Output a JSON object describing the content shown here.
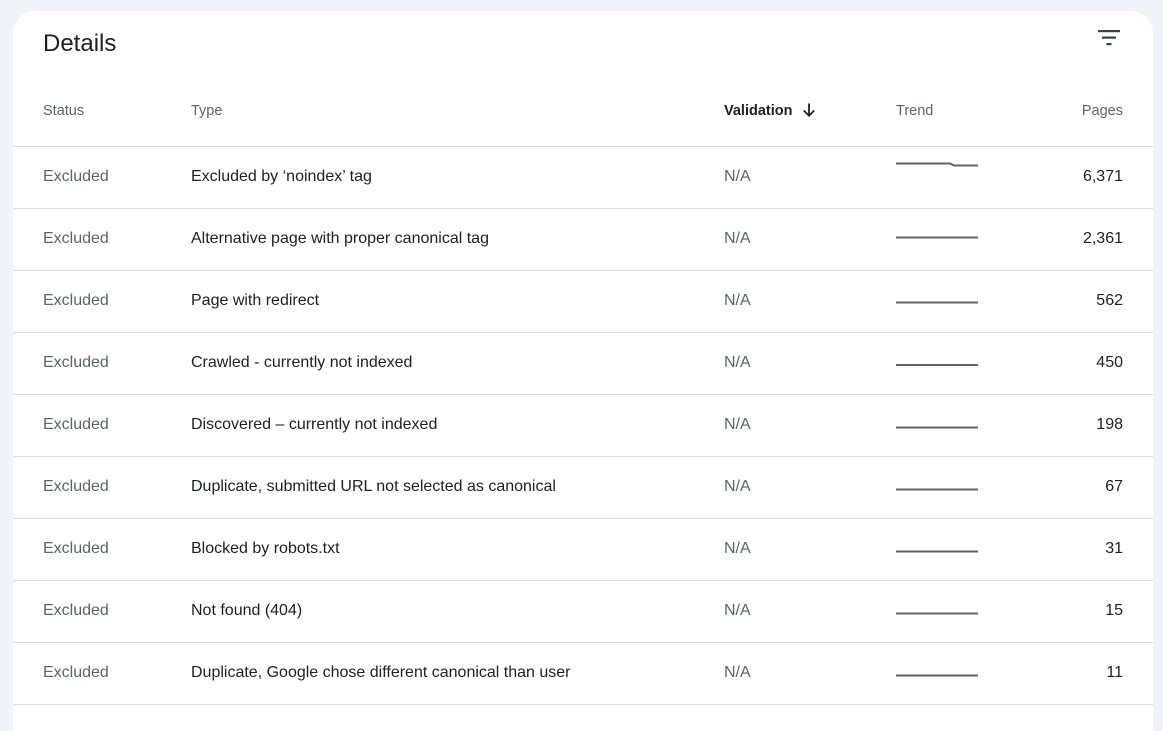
{
  "card": {
    "title": "Details",
    "filter_icon": "filter-list-icon"
  },
  "columns": {
    "status": "Status",
    "type": "Type",
    "validation": "Validation",
    "trend": "Trend",
    "pages": "Pages",
    "sort_icon": "arrow-down-icon"
  },
  "rows": [
    {
      "status": "Excluded",
      "type": "Excluded by ‘noindex’ tag",
      "validation": "N/A",
      "pages": "6,371"
    },
    {
      "status": "Excluded",
      "type": "Alternative page with proper canonical tag",
      "validation": "N/A",
      "pages": "2,361"
    },
    {
      "status": "Excluded",
      "type": "Page with redirect",
      "validation": "N/A",
      "pages": "562"
    },
    {
      "status": "Excluded",
      "type": "Crawled - currently not indexed",
      "validation": "N/A",
      "pages": "450"
    },
    {
      "status": "Excluded",
      "type": "Discovered – currently not indexed",
      "validation": "N/A",
      "pages": "198"
    },
    {
      "status": "Excluded",
      "type": "Duplicate, submitted URL not selected as canonical",
      "validation": "N/A",
      "pages": "67"
    },
    {
      "status": "Excluded",
      "type": "Blocked by robots.txt",
      "validation": "N/A",
      "pages": "31"
    },
    {
      "status": "Excluded",
      "type": "Not found (404)",
      "validation": "N/A",
      "pages": "15"
    },
    {
      "status": "Excluded",
      "type": "Duplicate, Google chose different canonical than user",
      "validation": "N/A",
      "pages": "11"
    }
  ],
  "colors": {
    "background": "#f1f3fa",
    "card": "#ffffff",
    "divider": "#dadce0",
    "muted_text": "#5f6368",
    "text": "#202124",
    "trend_line": "#5f6368"
  }
}
